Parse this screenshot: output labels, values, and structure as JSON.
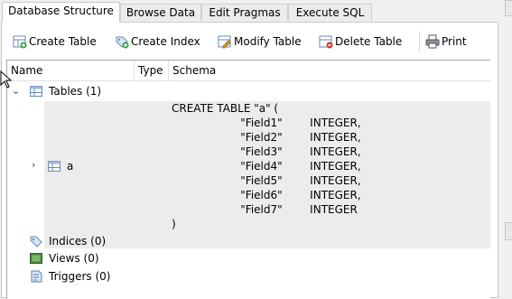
{
  "tabs": [
    {
      "label": "Database Structure",
      "active": true
    },
    {
      "label": "Browse Data",
      "active": false
    },
    {
      "label": "Edit Pragmas",
      "active": false
    },
    {
      "label": "Execute SQL",
      "active": false
    }
  ],
  "toolbar": {
    "create_table": "Create Table",
    "create_index": "Create Index",
    "modify_table": "Modify Table",
    "delete_table": "Delete Table",
    "print": "Print"
  },
  "columns": {
    "name": "Name",
    "type": "Type",
    "schema": "Schema"
  },
  "tree": {
    "tables_label": "Tables (1)",
    "table_a_name": "a",
    "indices_label": "Indices (0)",
    "views_label": "Views (0)",
    "triggers_label": "Triggers (0)"
  },
  "schema_lines": [
    "CREATE TABLE \"a\" (",
    "                    \"Field1\"        INTEGER,",
    "                    \"Field2\"        INTEGER,",
    "                    \"Field3\"        INTEGER,",
    "                    \"Field4\"        INTEGER,",
    "                    \"Field5\"        INTEGER,",
    "                    \"Field6\"        INTEGER,",
    "                    \"Field7\"        INTEGER",
    ")"
  ],
  "colors": {
    "accent_blue": "#3a7bd5",
    "selection_gray": "#ececec"
  }
}
